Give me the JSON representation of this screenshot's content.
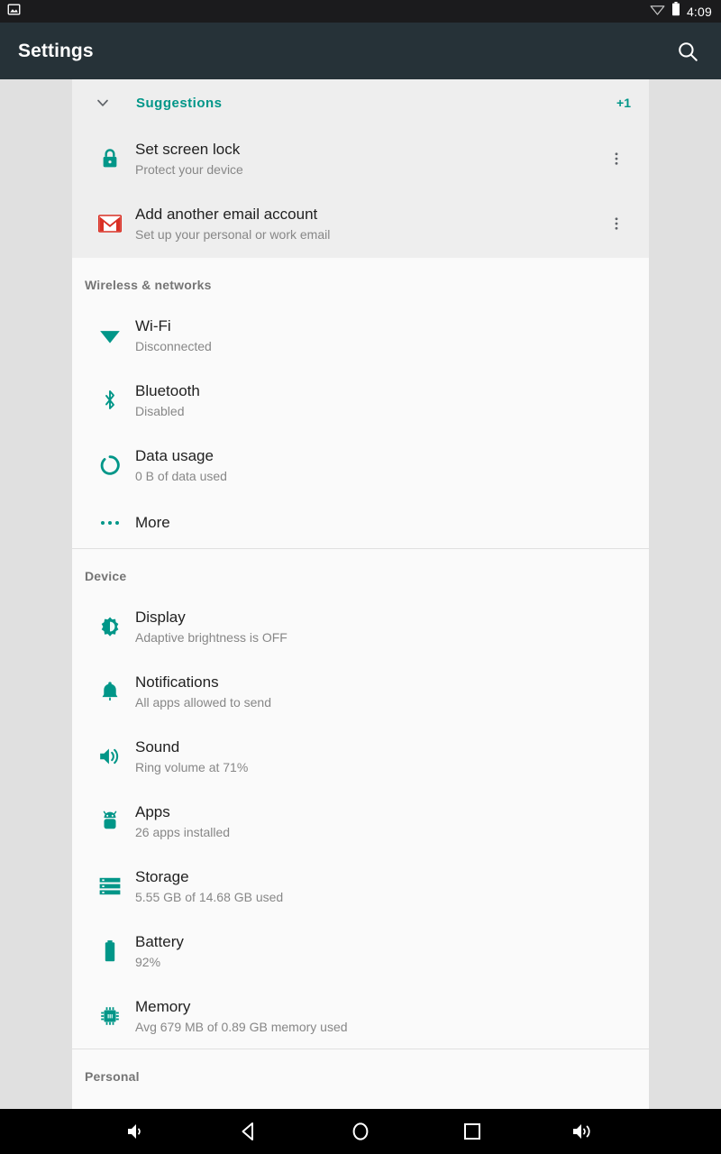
{
  "status_bar": {
    "time": "4:09",
    "left_icon": "screenshot-icon",
    "wifi_icon": "wifi-off-icon",
    "battery_icon": "battery-icon"
  },
  "action_bar": {
    "title": "Settings",
    "search_icon": "search-icon"
  },
  "suggestions": {
    "header_label": "Suggestions",
    "count_label": "+1",
    "expand_icon": "chevron-down-icon",
    "accent_color": "#009688",
    "items": [
      {
        "icon": "lock-icon",
        "title": "Set screen lock",
        "subtitle": "Protect your device",
        "overflow_icon": "more-vert-icon"
      },
      {
        "icon": "gmail-icon",
        "title": "Add another email account",
        "subtitle": "Set up your personal or work email",
        "overflow_icon": "more-vert-icon"
      }
    ]
  },
  "sections": [
    {
      "header": "Wireless & networks",
      "rows": [
        {
          "icon": "wifi-icon",
          "title": "Wi-Fi",
          "subtitle": "Disconnected"
        },
        {
          "icon": "bluetooth-icon",
          "title": "Bluetooth",
          "subtitle": "Disabled"
        },
        {
          "icon": "data-usage-icon",
          "title": "Data usage",
          "subtitle": "0 B of data used"
        },
        {
          "icon": "more-horiz-icon",
          "title": "More",
          "subtitle": ""
        }
      ]
    },
    {
      "header": "Device",
      "rows": [
        {
          "icon": "brightness-icon",
          "title": "Display",
          "subtitle": "Adaptive brightness is OFF"
        },
        {
          "icon": "bell-icon",
          "title": "Notifications",
          "subtitle": "All apps allowed to send"
        },
        {
          "icon": "volume-icon",
          "title": "Sound",
          "subtitle": "Ring volume at 71%"
        },
        {
          "icon": "android-icon",
          "title": "Apps",
          "subtitle": "26 apps installed"
        },
        {
          "icon": "storage-icon",
          "title": "Storage",
          "subtitle": "5.55 GB of 14.68 GB used"
        },
        {
          "icon": "battery-full-icon",
          "title": "Battery",
          "subtitle": "92%"
        },
        {
          "icon": "memory-chip-icon",
          "title": "Memory",
          "subtitle": "Avg 679 MB of 0.89 GB memory used"
        }
      ]
    },
    {
      "header": "Personal",
      "rows": []
    }
  ],
  "nav_bar": {
    "buttons": [
      {
        "icon": "volume-down-icon",
        "label": "Volume down"
      },
      {
        "icon": "back-icon",
        "label": "Back"
      },
      {
        "icon": "home-icon",
        "label": "Home"
      },
      {
        "icon": "recents-icon",
        "label": "Recent apps"
      },
      {
        "icon": "volume-up-icon",
        "label": "Volume up"
      }
    ]
  },
  "colors": {
    "accent": "#009688",
    "action_bar": "#263238",
    "status_bar": "#1b1b1d",
    "page_background": "#e0e0e0",
    "list_background": "#fafafa",
    "card_background": "#eeeeee",
    "gmail_red": "#d93025"
  }
}
